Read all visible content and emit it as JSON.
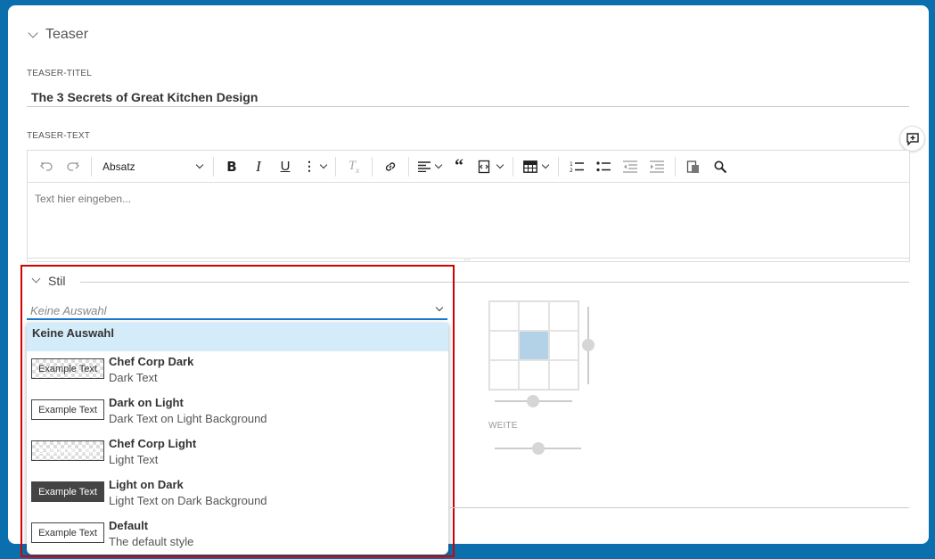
{
  "teaser": {
    "section_title": "Teaser",
    "title_label": "TEASER-TITEL",
    "title_value": "The 3 Secrets of Great Kitchen Design",
    "text_label": "TEASER-TEXT",
    "editor_placeholder": "Text hier eingeben...",
    "paragraph_format": "Absatz"
  },
  "toolbar_icons": [
    "undo-icon",
    "redo-icon",
    "bold-icon",
    "italic-icon",
    "underline-icon",
    "more-icon",
    "remove-format-icon",
    "link-icon",
    "align-icon",
    "blockquote-icon",
    "code-block-icon",
    "table-icon",
    "numbered-list-icon",
    "bulleted-list-icon",
    "outdent-icon",
    "indent-icon",
    "paste-icon",
    "find-replace-icon",
    "add-comment-icon"
  ],
  "stil": {
    "section_title": "Stil",
    "select_placeholder": "Keine Auswahl",
    "none_option": "Keine Auswahl",
    "options": [
      {
        "swatch": "Example Text",
        "name": "Chef Corp Dark",
        "desc": "Dark Text"
      },
      {
        "swatch": "Example Text",
        "name": "Dark on Light",
        "desc": "Dark Text on Light Background"
      },
      {
        "swatch": "Example Text",
        "name": "Chef Corp Light",
        "desc": "Light Text"
      },
      {
        "swatch": "Example Text",
        "name": "Light on Dark",
        "desc": "Light Text on Dark Background"
      },
      {
        "swatch": "Example Text",
        "name": "Default",
        "desc": "The default style"
      }
    ],
    "width_label": "WEITE"
  },
  "colors": {
    "accent": "#1976d2",
    "highlight": "#d60000",
    "selected_bg": "#d4ebf9",
    "frame_bg": "#0b6fae"
  }
}
